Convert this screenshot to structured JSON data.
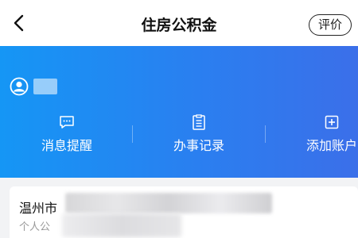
{
  "header": {
    "title": "住房公积金",
    "rate_label": "评价"
  },
  "colors": {
    "accent_start": "#1596f5",
    "accent_end": "#3b6fe9"
  },
  "icons": {
    "back": "back-arrow-icon",
    "user": "user-circle-icon",
    "messages": "chat-bubble-icon",
    "records": "document-list-icon",
    "add_account": "plus-square-icon"
  },
  "actions": [
    {
      "label": "消息提醒"
    },
    {
      "label": "办事记录"
    },
    {
      "label": "添加账户"
    }
  ],
  "card": {
    "title": "温州市",
    "subtitle": "个人公"
  }
}
